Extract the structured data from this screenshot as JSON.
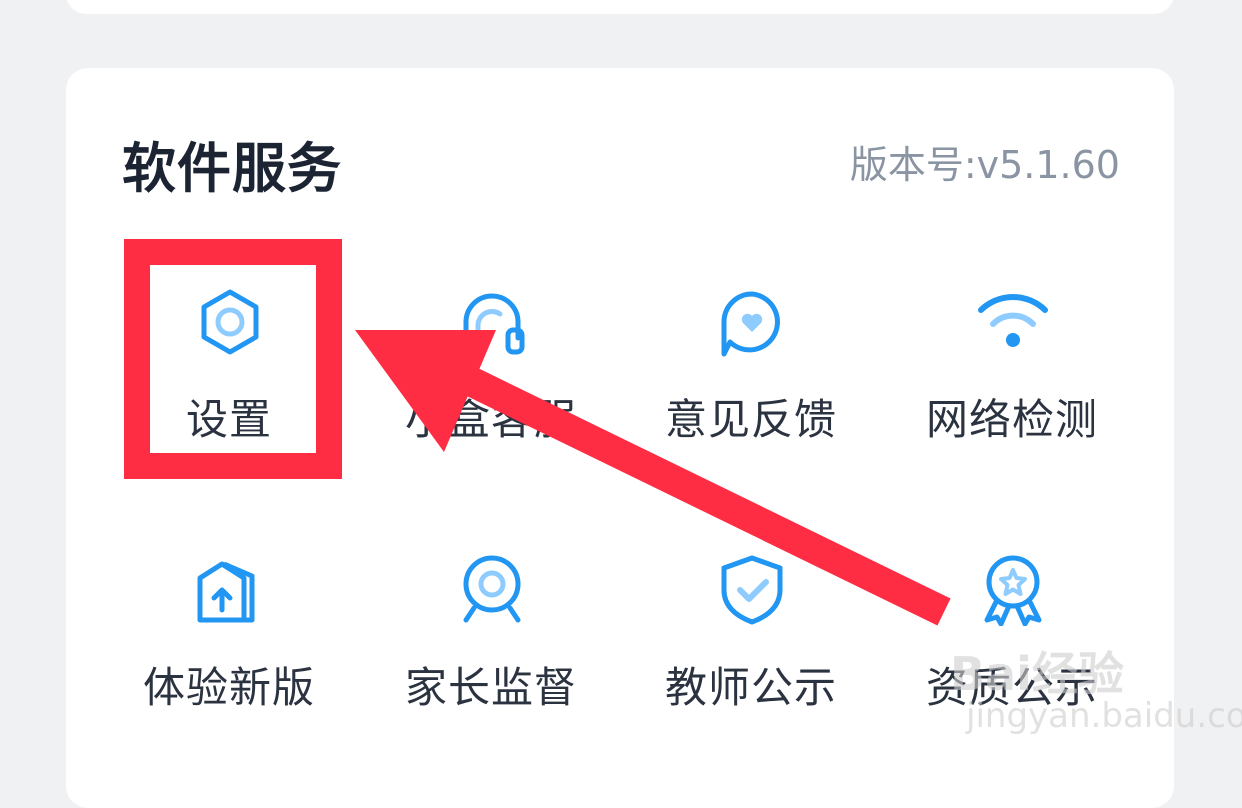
{
  "section": {
    "title": "软件服务",
    "version": "版本号:v5.1.60"
  },
  "items": [
    {
      "label": "设置",
      "icon": "gear-hexagon-icon"
    },
    {
      "label": "小盒客服",
      "icon": "headset-icon"
    },
    {
      "label": "意见反馈",
      "icon": "heart-chat-icon"
    },
    {
      "label": "网络检测",
      "icon": "wifi-icon"
    },
    {
      "label": "体验新版",
      "icon": "upgrade-house-icon"
    },
    {
      "label": "家长监督",
      "icon": "webcam-icon"
    },
    {
      "label": "教师公示",
      "icon": "shield-check-icon"
    },
    {
      "label": "资质公示",
      "icon": "award-badge-icon"
    }
  ],
  "colors": {
    "icon": "#2196f3",
    "icon_light": "#8ecbff",
    "highlight": "#ff2d44"
  },
  "watermark": {
    "brand": "Bai经验",
    "url": "jingyan.baidu.com"
  }
}
